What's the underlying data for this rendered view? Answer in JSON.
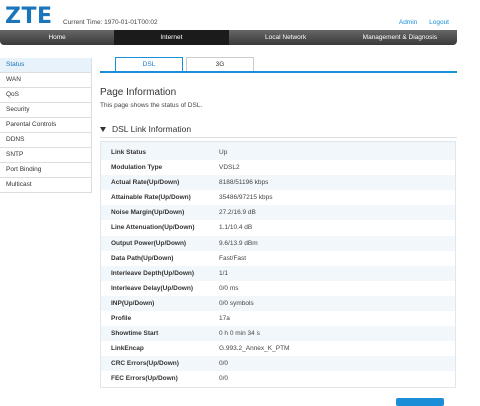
{
  "brand": "ZTE",
  "current_time_label": "Current Time: 1970-01-01T00:02",
  "top_links": {
    "admin": "Admin",
    "logout": "Logout"
  },
  "nav": [
    "Home",
    "Internet",
    "Local Network",
    "Management & Diagnosis"
  ],
  "sidebar": [
    "Status",
    "WAN",
    "QoS",
    "Security",
    "Parental Controls",
    "DDNS",
    "SNTP",
    "Port Binding",
    "Multicast"
  ],
  "tabs": [
    "DSL",
    "3G"
  ],
  "page": {
    "title": "Page Information",
    "description": "This page shows the status of DSL.",
    "section_title": "DSL Link Information"
  },
  "rows": [
    {
      "label": "Link Status",
      "value": "Up"
    },
    {
      "label": "Modulation Type",
      "value": "VDSL2"
    },
    {
      "label": "Actual Rate(Up/Down)",
      "value": "8188/51196 kbps"
    },
    {
      "label": "Attainable Rate(Up/Down)",
      "value": "35486/97215 kbps"
    },
    {
      "label": "Noise Margin(Up/Down)",
      "value": "27.2/16.9 dB"
    },
    {
      "label": "Line Attenuation(Up/Down)",
      "value": "1.1/10.4 dB"
    },
    {
      "label": "Output Power(Up/Down)",
      "value": "9.6/13.9 dBm"
    },
    {
      "label": "Data Path(Up/Down)",
      "value": "Fast/Fast"
    },
    {
      "label": "Interleave Depth(Up/Down)",
      "value": "1/1"
    },
    {
      "label": "Interleave Delay(Up/Down)",
      "value": "0/0 ms"
    },
    {
      "label": "INP(Up/Down)",
      "value": "0/0 symbols"
    },
    {
      "label": "Profile",
      "value": "17a"
    },
    {
      "label": "Showtime Start",
      "value": "0 h 0 min 34 s"
    },
    {
      "label": "LinkEncap",
      "value": "G.993.2_Annex_K_PTM"
    },
    {
      "label": "CRC Errors(Up/Down)",
      "value": "0/0"
    },
    {
      "label": "FEC Errors(Up/Down)",
      "value": "0/0"
    }
  ],
  "colors": {
    "accent": "#1a8fd8",
    "brand": "#1a75bb",
    "nav_bg": "#4a4a4a"
  }
}
